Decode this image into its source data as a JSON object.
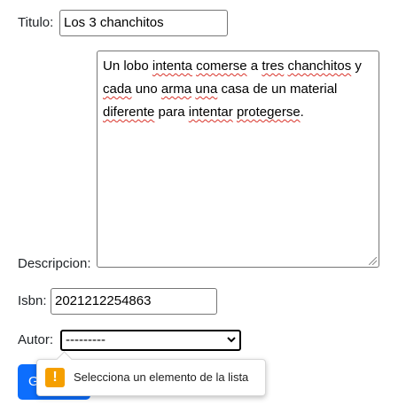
{
  "form": {
    "titulo": {
      "label": "Titulo:",
      "value": "Los 3 chanchitos"
    },
    "descripcion": {
      "label": "Descripcion:",
      "segments": [
        {
          "text": "Un lobo ",
          "spell": false
        },
        {
          "text": "intenta",
          "spell": true
        },
        {
          "text": " ",
          "spell": false
        },
        {
          "text": "comerse",
          "spell": true
        },
        {
          "text": " a ",
          "spell": false
        },
        {
          "text": "tres",
          "spell": true
        },
        {
          "text": " ",
          "spell": false
        },
        {
          "text": "chanchitos",
          "spell": true
        },
        {
          "text": " y ",
          "spell": false
        },
        {
          "text": "cada",
          "spell": true
        },
        {
          "text": " uno ",
          "spell": false
        },
        {
          "text": "arma",
          "spell": true
        },
        {
          "text": " ",
          "spell": false
        },
        {
          "text": "una",
          "spell": true
        },
        {
          "text": " casa de un material ",
          "spell": false
        },
        {
          "text": "diferente",
          "spell": true
        },
        {
          "text": " para ",
          "spell": false
        },
        {
          "text": "intentar",
          "spell": true
        },
        {
          "text": " ",
          "spell": false
        },
        {
          "text": "protegerse",
          "spell": true
        },
        {
          "text": ".",
          "spell": false
        }
      ]
    },
    "isbn": {
      "label": "Isbn:",
      "value": "2021212254863"
    },
    "autor": {
      "label": "Autor:",
      "selected": "---------"
    },
    "submit_label": "Guardar"
  },
  "validation_tooltip": {
    "icon": "warning-icon",
    "text": "Selecciona un elemento de la lista"
  },
  "colors": {
    "primary_button": "#0d6efd",
    "warning": "#f59f00",
    "spellcheck": "#d9342b"
  }
}
